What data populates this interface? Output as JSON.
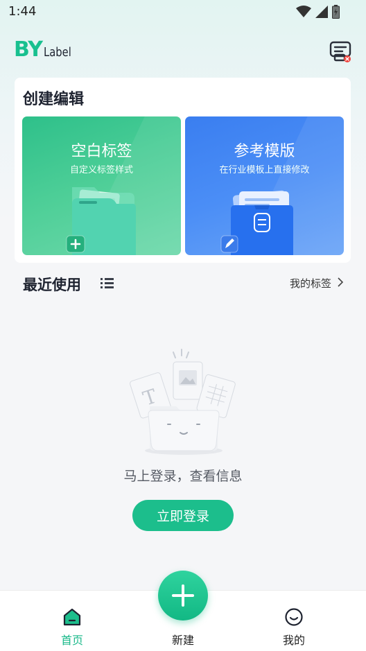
{
  "status_bar": {
    "time": "1:44",
    "icons": [
      "wifi-icon",
      "signal-icon",
      "battery-icon"
    ]
  },
  "header": {
    "logo_main": "BY",
    "logo_sub": "Label",
    "printer_icon": "printer-disconnected-icon"
  },
  "create_section": {
    "title": "创建编辑",
    "tiles": [
      {
        "title": "空白标签",
        "subtitle": "自定义标签样式",
        "color": "#2ec08a",
        "icon": "folder-add-icon"
      },
      {
        "title": "参考模版",
        "subtitle": "在行业模板上直接修改",
        "color": "#3a7ef0",
        "icon": "template-edit-icon"
      }
    ]
  },
  "recent_section": {
    "title": "最近使用",
    "my_labels_link": "我的标签",
    "empty_message": "马上登录，查看信息",
    "login_button": "立即登录"
  },
  "bottom_nav": {
    "items": [
      {
        "label": "首页",
        "icon": "home-icon",
        "active": true
      },
      {
        "label": "新建",
        "icon": "plus-icon",
        "active": false
      },
      {
        "label": "我的",
        "icon": "smile-icon",
        "active": false
      }
    ]
  },
  "colors": {
    "accent": "#1cbe8c",
    "blank_tile": "#2ec08a",
    "template_tile": "#3a7ef0"
  }
}
